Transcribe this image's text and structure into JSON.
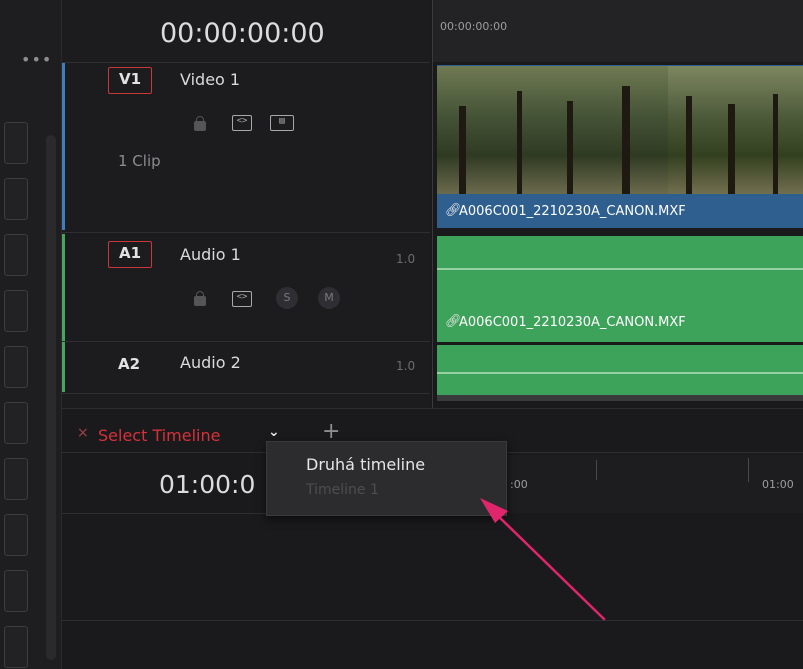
{
  "header": {
    "timecode": "00:00:00:00"
  },
  "ruler": {
    "timecode": "00:00:00:00"
  },
  "tracks": [
    {
      "id": "V1",
      "name": "Video 1",
      "info": "1 Clip",
      "icons": [
        "lock-icon",
        "auto-select-icon",
        "film-icon"
      ]
    },
    {
      "id": "A1",
      "name": "Audio 1",
      "version": "1.0",
      "icons": [
        "lock-icon",
        "auto-select-icon",
        "solo-icon",
        "mute-icon"
      ],
      "solo": "S",
      "mute": "M"
    },
    {
      "id": "A2",
      "name": "Audio 2",
      "version": "1.0"
    }
  ],
  "clips": {
    "video": "A006C001_2210230A_CANON.MXF",
    "audio": "A006C001_2210230A_CANON.MXF"
  },
  "timeline_tab": {
    "close": "×",
    "label": "Select Timeline",
    "chevron": "⌄",
    "add": "+"
  },
  "lower": {
    "timecode": "01:00:0",
    "ruler_a": ":00",
    "ruler_b": "01:00"
  },
  "dropdown": {
    "options": [
      "Druhá timeline",
      "Timeline 1"
    ]
  },
  "colors": {
    "accent_red": "#d6313a",
    "video_clip": "#2e5f8f",
    "audio_clip": "#3ea35a",
    "annotation_arrow": "#e0256c"
  }
}
